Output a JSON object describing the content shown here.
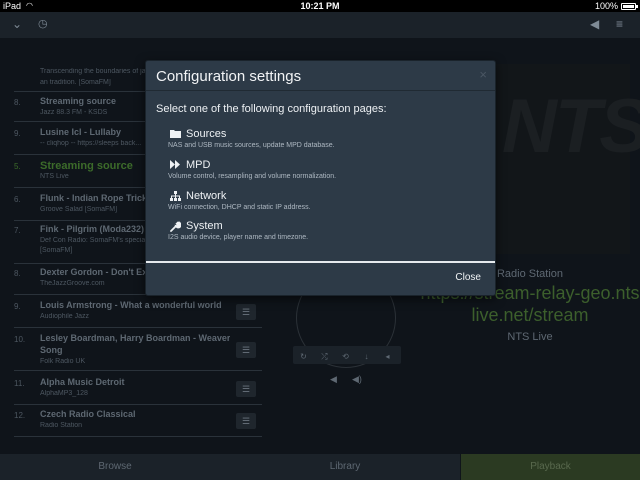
{
  "statusbar": {
    "device": "iPad",
    "wifi_icon": "wifi-icon",
    "time": "10:21 PM",
    "battery": "100%"
  },
  "header": {
    "left_icons": [
      "chevron-down-icon",
      "clock-icon"
    ],
    "right_icons": [
      "volume-icon",
      "menu-icon"
    ]
  },
  "playlist": [
    {
      "num": "",
      "title": "Transcending the boundaries of ja...",
      "sub": "an tradition. [SomaFM]",
      "sub2": ""
    },
    {
      "num": "8.",
      "title": "Streaming source",
      "sub": "Jazz 88.3 FM - KSDS",
      "sub2": ""
    },
    {
      "num": "9.",
      "title": "Lusine Icl - Lullaby",
      "sub": "-- cliqhop -- https://sleeps back...",
      "sub2": ""
    },
    {
      "num": "5.",
      "title": "Streaming source",
      "sub": "NTS Live",
      "sub2": ""
    },
    {
      "num": "6.",
      "title": "Flunk - Indian Rope Trick",
      "sub": "Groove Salad [SomaFM]",
      "sub2": ""
    },
    {
      "num": "7.",
      "title": "Fink - Pilgrim (Moda232)",
      "sub": "Def Con Radio: SomaFM's specia...",
      "sub2": "[SomaFM]"
    },
    {
      "num": "8.",
      "title": "Dexter Gordon - Don't Explain",
      "sub": "TheJazzGroove.com",
      "sub2": ""
    },
    {
      "num": "9.",
      "title": "Louis Armstrong - What a wonderful world",
      "sub": "Audiophile Jazz",
      "sub2": ""
    },
    {
      "num": "10.",
      "title": "Lesley Boardman, Harry Boardman - Weaver's",
      "title2": "Song",
      "sub": "Folk Radio UK",
      "sub2": ""
    },
    {
      "num": "11.",
      "title": "Alpha Music Detroit",
      "sub": "AlphaMP3_128",
      "sub2": ""
    },
    {
      "num": "12.",
      "title": "Czech Radio Classical",
      "sub": "Radio Station",
      "sub2": ""
    }
  ],
  "now_playing": {
    "cover_text": "NTS",
    "station_label": "Radio Station",
    "url": "https://stream-relay-geo.ntslive.net/stream",
    "name": "NTS Live",
    "controls": [
      "repeat-icon",
      "shuffle-icon",
      "refresh-icon",
      "download-icon",
      "prev-icon"
    ],
    "volume": [
      "volume-down-icon",
      "volume-up-icon"
    ]
  },
  "tabs": {
    "browse": "Browse",
    "library": "Library",
    "playback": "Playback"
  },
  "modal": {
    "title": "Configuration settings",
    "close_x": "×",
    "intro": "Select one of the following configuration pages:",
    "options": [
      {
        "icon": "folder-icon",
        "label": "Sources",
        "desc": "NAS and USB music sources, update MPD database."
      },
      {
        "icon": "fast-forward-icon",
        "label": "MPD",
        "desc": "Volume control, resampling and volume normalization."
      },
      {
        "icon": "network-icon",
        "label": "Network",
        "desc": "WiFi connection, DHCP and static IP address."
      },
      {
        "icon": "wrench-icon",
        "label": "System",
        "desc": "I2S audio device, player name and timezone."
      }
    ],
    "close_label": "Close"
  },
  "colors": {
    "accent_green": "#4caf2f",
    "modal_bg": "#2d3a47",
    "app_bg": "#0f141a"
  }
}
